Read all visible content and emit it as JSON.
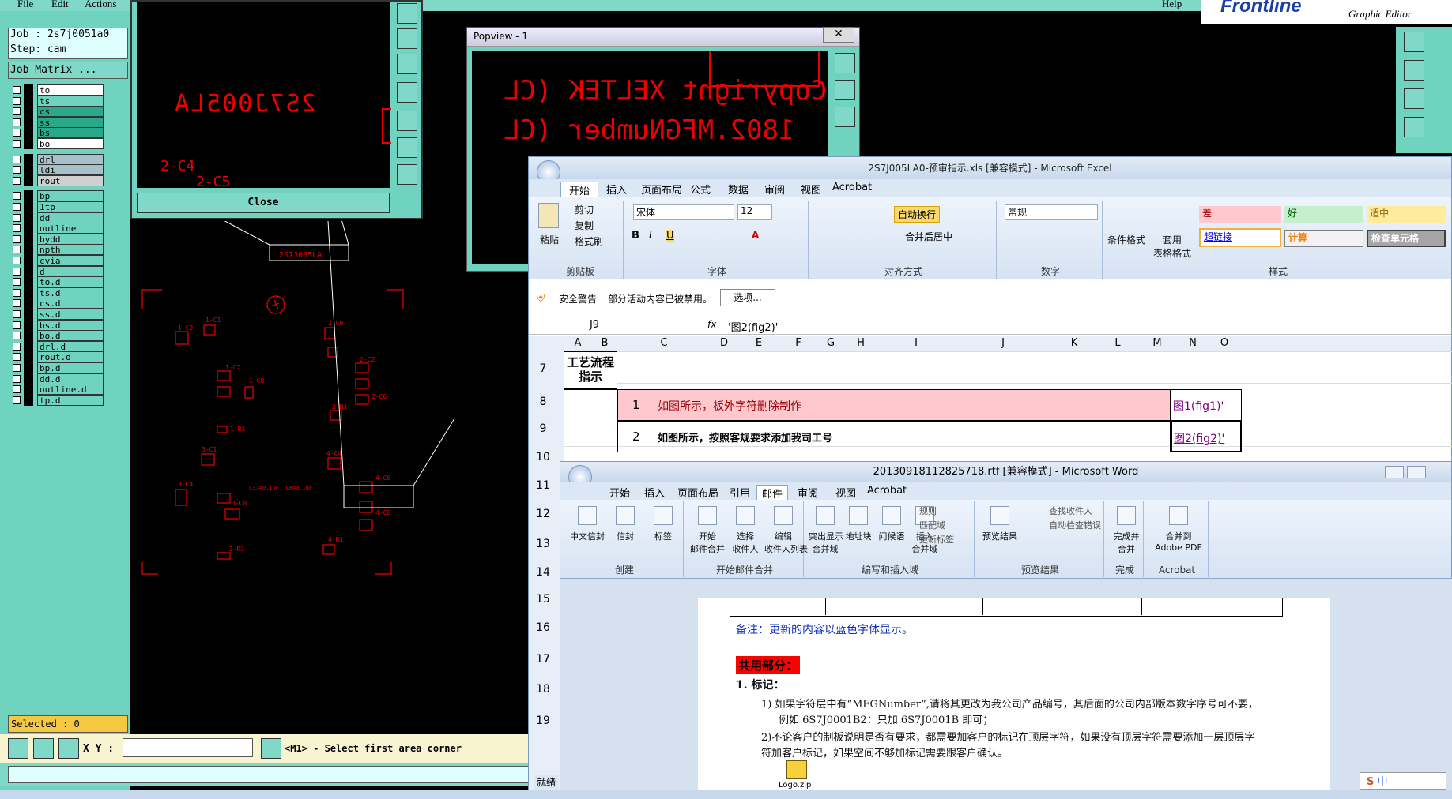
{
  "frontline": {
    "menu": {
      "file": "File",
      "edit": "Edit",
      "actions": "Actions",
      "help": "Help"
    },
    "logo": "Frontline",
    "logo_sub": "Graphic Editor",
    "job": "Job : 2s7j0051a0",
    "step": "Step: cam",
    "job_matrix": "Job Matrix ...",
    "layers": [
      "to",
      "ts",
      "cs",
      "ss",
      "bs",
      "bo",
      "drl",
      "ldi",
      "rout",
      "bp",
      "1tp",
      "dd",
      "outline",
      "bydd",
      "npth",
      "cvia",
      "d",
      "to.d",
      "ts.d",
      "cs.d",
      "ss.d",
      "bs.d",
      "bo.d",
      "drl.d",
      "rout.d",
      "bp.d",
      "dd.d",
      "outline.d",
      "tp.d"
    ],
    "selected": "Selected : 0",
    "xy_label": "X Y :",
    "prompt": "<M1> - Select first area corner",
    "close": "Close",
    "zoom_text": "2S7J005LA",
    "board_text_lines": [
      "2-C4",
      "2-C5"
    ]
  },
  "popview": {
    "title": "Popview - 1",
    "line1": "Copyright XELTEK (CL",
    "line2": "1802.MFGNumber (CL"
  },
  "excel": {
    "title": "2S7J005LA0-预审指示.xls  [兼容模式]  -  Microsoft Excel",
    "tabs": [
      "开始",
      "插入",
      "页面布局",
      "公式",
      "数据",
      "审阅",
      "视图",
      "Acrobat"
    ],
    "clipboard": {
      "paste": "粘贴",
      "cut": "剪切",
      "copy": "复制",
      "format_painter": "格式刷",
      "group": "剪贴板"
    },
    "font": {
      "name": "宋体",
      "size": "12",
      "group": "字体"
    },
    "align": {
      "wrap": "自动换行",
      "merge": "合并后居中",
      "group": "对齐方式"
    },
    "number": {
      "format": "常规",
      "group": "数字"
    },
    "styles": {
      "cond": "条件格式",
      "table": "套用\n表格格式",
      "bad": "差",
      "good": "好",
      "neutral": "适中",
      "hyperlink": "超链接",
      "calc": "计算",
      "check": "检查单元格",
      "group": "样式"
    },
    "security_label": "安全警告",
    "security_msg": "部分活动内容已被禁用。",
    "options": "选项...",
    "cell_ref": "J9",
    "formula": "'图2(fig2)'",
    "columns": [
      "A",
      "B",
      "C",
      "D",
      "E",
      "F",
      "G",
      "H",
      "I",
      "J",
      "K",
      "L",
      "M",
      "N",
      "O"
    ],
    "rows": [
      "7",
      "8",
      "9",
      "10",
      "11",
      "12",
      "13",
      "14",
      "15",
      "16",
      "17",
      "18",
      "19"
    ],
    "header_cell": "工艺流程\n指示",
    "row8": {
      "num": "1",
      "text": "如图所示，板外字符删除制作",
      "link": "图1(fig1)'"
    },
    "row9": {
      "num": "2",
      "text": "如图所示，按照客规要求添加我司工号",
      "link": "图2(fig2)'"
    },
    "status": "就绪"
  },
  "word": {
    "title": "20130918112825718.rtf [兼容模式] - Microsoft Word",
    "tabs": [
      "开始",
      "插入",
      "页面布局",
      "引用",
      "邮件",
      "审阅",
      "视图",
      "Acrobat"
    ],
    "groups": {
      "create": {
        "label": "创建",
        "items": [
          "中文信封",
          "信封",
          "标签"
        ]
      },
      "merge": {
        "label": "开始邮件合并",
        "items": [
          "开始\n邮件合并",
          "选择\n收件人",
          "编辑\n收件人列表"
        ]
      },
      "insert": {
        "label": "编写和插入域",
        "items": [
          "突出显示\n合并域",
          "地址块",
          "问候语",
          "插入\n合并域"
        ],
        "side": [
          "规则",
          "匹配域",
          "更新标签"
        ]
      },
      "preview": {
        "label": "预览结果",
        "items": [
          "预览结果"
        ],
        "side": [
          "查找收件人",
          "自动检查错误"
        ]
      },
      "finish": {
        "label": "完成",
        "items": [
          "完成并\n合并"
        ]
      },
      "acrobat": {
        "label": "Acrobat",
        "items": [
          "合并到\nAdobe PDF"
        ]
      }
    },
    "note": "备注：更新的内容以蓝色字体显示。",
    "section": "共用部分：",
    "item1": "1.   标记：",
    "sub1": "1)  如果字符层中有“MFGNumber”,请将其更改为我公司产品编号，其后面的公司内部版本数字序号可不要，",
    "sub1b": "例如 6S7J0001B2：只加 6S7J0001B 即可；",
    "sub2": "2)不论客户的制板说明是否有要求，都需要加客户的标记在顶层字符，如果没有顶层字符需要添加一层顶层字",
    "sub2b": "符加客户标记，如果空间不够加标记需要跟客户确认。",
    "attachment": "Logo.zip"
  },
  "ime": {
    "label": "中"
  }
}
